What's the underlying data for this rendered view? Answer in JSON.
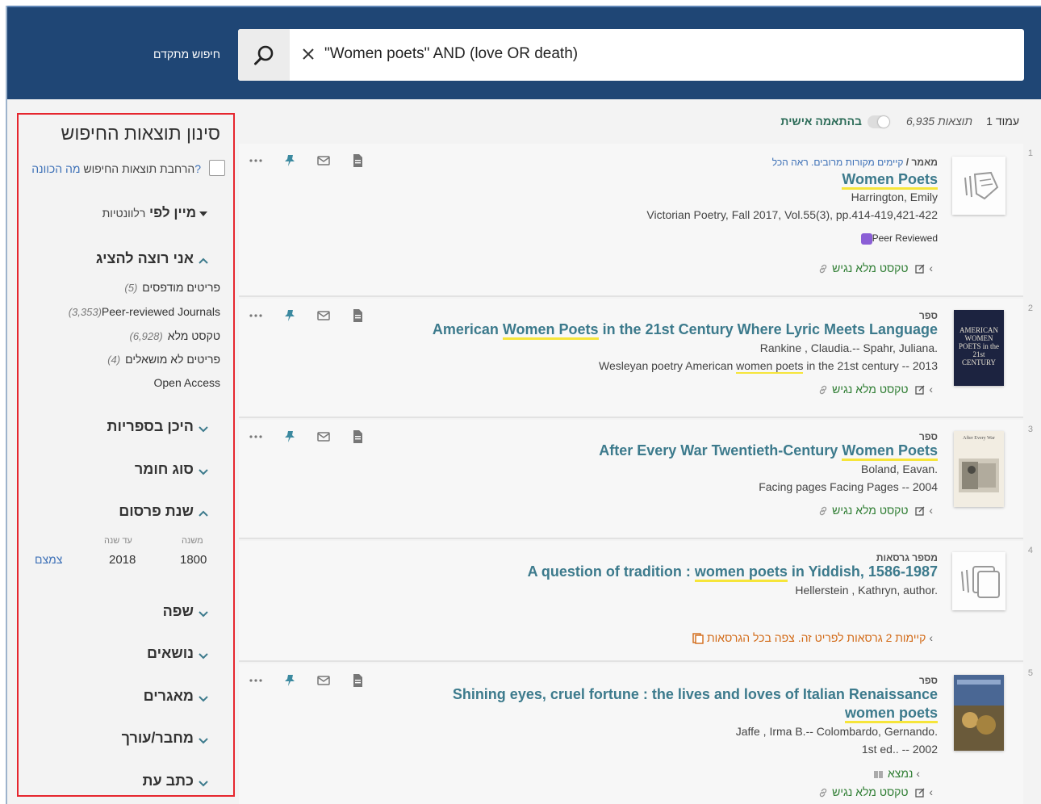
{
  "header": {
    "advanced_search": "חיפוש מתקדם",
    "query": "\"Women poets\" AND (love OR death)"
  },
  "facets": {
    "title": "סינון תוצאות החיפוש",
    "expand_label": "הרחבת תוצאות החיפוש",
    "expand_help": "מה הכוונה?",
    "sort_label": "מיין לפי",
    "sort_value": "רלוונטיות",
    "show_only": {
      "heading": "אני רוצה להציג",
      "options": [
        {
          "label": "פריטים מודפסים",
          "count": "(5)"
        },
        {
          "label": "Peer-reviewed Journals",
          "count": "(3,353)"
        },
        {
          "label": "טקסט מלא",
          "count": "(6,928)"
        },
        {
          "label": "פריטים לא מושאלים",
          "count": "(4)"
        },
        {
          "label": "Open Access",
          "count": ""
        }
      ]
    },
    "library_location": "היכן בספריות",
    "resource_type": "סוג חומר",
    "pub_year": {
      "heading": "שנת פרסום",
      "from_label": "משנה",
      "to_label": "עד שנה",
      "from": "1800",
      "to": "2018",
      "apply": "צמצם"
    },
    "language": "שפה",
    "subjects": "נושאים",
    "databases": "מאגרים",
    "author": "מחבר/עורך",
    "journal": "כתב עת"
  },
  "results_header": {
    "page": "עמוד 1",
    "count": "6,935 תוצאות",
    "personalize": "בהתאמה אישית"
  },
  "results": [
    {
      "num": "1",
      "type": "מאמר /",
      "type_extra": "קיימים מקורות מרובים. ראה הכל",
      "title": "Women Poets",
      "author": "Harrington, Emily",
      "source": "Victorian Poetry, Fall 2017, Vol.55(3), pp.414-419,421-422",
      "peer": "Peer Reviewed",
      "availability": "טקסט מלא נגיש"
    },
    {
      "num": "2",
      "type": "ספר",
      "title_a": "American ",
      "title_hl": "Women Poets",
      "title_b": " in the 21st Century Where Lyric Meets Language",
      "author": "Rankine , Claudia.-- Spahr, Juliana.",
      "source_a": "Wesleyan poetry American ",
      "source_hl": "women poets",
      "source_b": " in the 21st century -- 2013",
      "availability": "טקסט מלא נגיש",
      "cover_text": "AMERICAN WOMEN POETS in the 21st CENTURY"
    },
    {
      "num": "3",
      "type": "ספר",
      "title_a": "After Every War Twentieth-Century ",
      "title_hl": "Women Poets",
      "author": "Boland, Eavan.",
      "source": "Facing pages Facing Pages -- 2004",
      "availability": "טקסט מלא נגיש",
      "cover_text": "After Every War"
    },
    {
      "num": "4",
      "type": "מספר גרסאות",
      "title_a": "A question of tradition : ",
      "title_hl": "women poets",
      "title_b": " in Yiddish, 1586-1987",
      "author": "Hellerstein , Kathryn, author.",
      "versions": "קיימות 2 גרסאות לפריט זה. צפה בכל הגרסאות"
    },
    {
      "num": "5",
      "type": "ספר",
      "title_a": "Shining eyes, cruel fortune : the lives and loves of Italian Renaissance",
      "title_hl": "women poets",
      "author": "Jaffe , Irma B.-- Colombardo, Gernando.",
      "edition": "1st ed.. -- 2002",
      "location": "נמצא",
      "availability": "טקסט מלא נגיש"
    }
  ]
}
